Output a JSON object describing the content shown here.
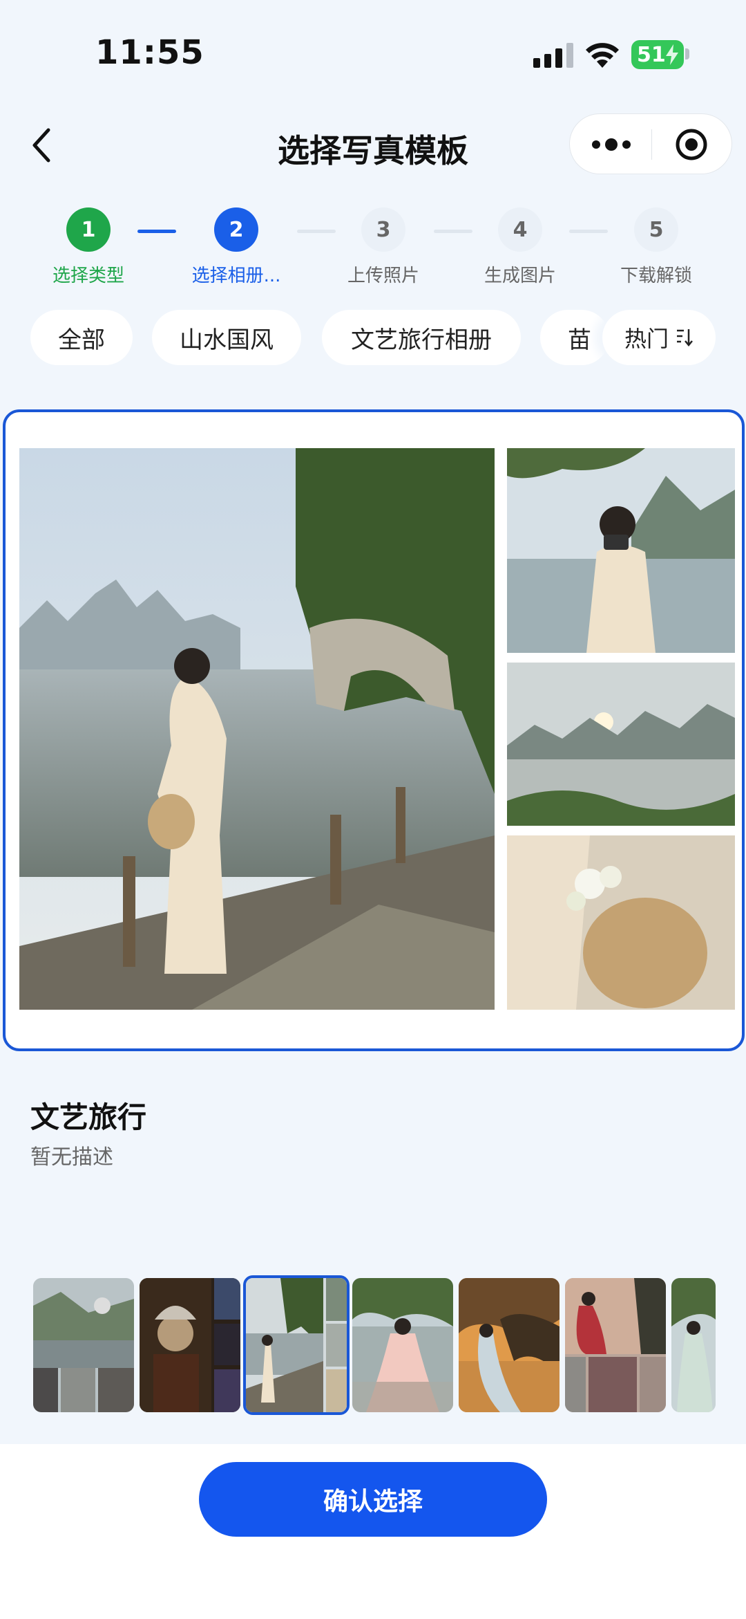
{
  "status_bar": {
    "time": "11:55",
    "battery": "51"
  },
  "nav": {
    "title": "选择写真模板"
  },
  "steps": [
    {
      "num": "1",
      "label": "选择类型",
      "state": "done"
    },
    {
      "num": "2",
      "label": "选择相册...",
      "state": "active"
    },
    {
      "num": "3",
      "label": "上传照片",
      "state": "todo"
    },
    {
      "num": "4",
      "label": "生成图片",
      "state": "todo"
    },
    {
      "num": "5",
      "label": "下载解锁",
      "state": "todo"
    }
  ],
  "categories": [
    "全部",
    "山水国风",
    "文艺旅行相册",
    "苗"
  ],
  "sort_label": "热门",
  "template": {
    "name": "文艺旅行",
    "description": "暂无描述"
  },
  "thumbnails_count": 7,
  "selected_thumbnail": 3,
  "confirm_label": "确认选择",
  "colors": {
    "primary": "#1456ee",
    "success": "#1fa64a",
    "background": "#f1f6fc"
  }
}
